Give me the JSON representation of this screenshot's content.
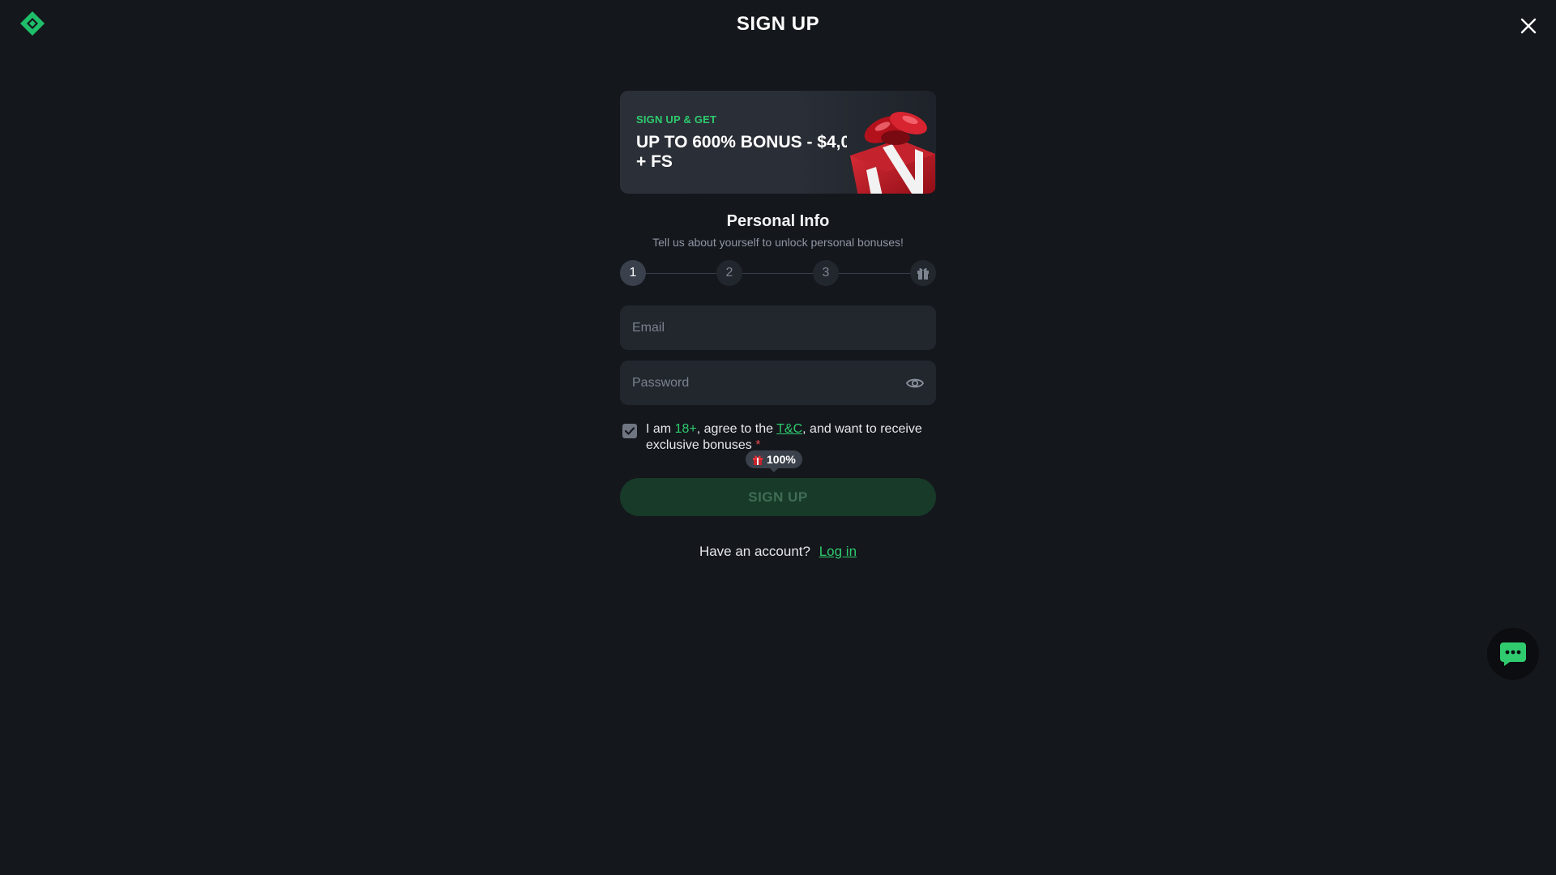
{
  "header": {
    "title": "SIGN UP",
    "logo_icon": "diamond-logo-icon",
    "close_icon": "close-icon"
  },
  "banner": {
    "kicker": "SIGN UP & GET",
    "headline_line1": "UP TO 600% BONUS - $4,0",
    "headline_line2": "+ FS",
    "art_icon": "gift-box-icon"
  },
  "personal_info": {
    "title": "Personal Info",
    "subtitle": "Tell us about yourself to unlock personal bonuses!"
  },
  "stepper": {
    "steps": [
      "1",
      "2",
      "3"
    ],
    "active_step": "1",
    "final_icon": "gift-icon"
  },
  "form": {
    "email_placeholder": "Email",
    "email_value": "",
    "password_placeholder": "Password",
    "password_value": "",
    "password_toggle_icon": "eye-icon"
  },
  "consent": {
    "checked": true,
    "text_prefix": "I am ",
    "age": "18+",
    "text_middle": ", agree to the ",
    "terms_link": "T&C",
    "text_suffix": ", and want to receive exclusive bonuses",
    "required_mark": "*"
  },
  "bonus_badge": {
    "icon": "gift-icon",
    "label": "100%"
  },
  "signup_button": {
    "label": "SIGN UP"
  },
  "login": {
    "prompt": "Have an account?",
    "link": "Log in"
  },
  "chat": {
    "icon": "chat-bubble-icon"
  },
  "colors": {
    "background": "#14171c",
    "accent_green": "#2fcb6e",
    "field_bg": "#22272e",
    "button_bg": "#183a29",
    "required_red": "#e5484d"
  }
}
